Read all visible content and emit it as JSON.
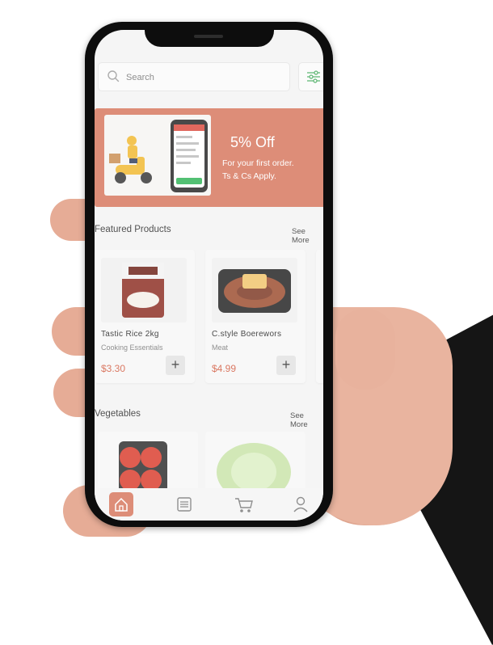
{
  "search": {
    "placeholder": "Search"
  },
  "banner": {
    "title": "5% Off",
    "subtitle_line1": "For your first order.",
    "subtitle_line2": "Ts & Cs Apply."
  },
  "featured": {
    "title": "Featured Products",
    "see_more": "See More",
    "products": [
      {
        "name": "Tastic  Rice 2kg",
        "category": "Cooking Essentials",
        "price": "$3.30"
      },
      {
        "name": "C.style Boerewors",
        "category": "Meat",
        "price": "$4.99"
      }
    ]
  },
  "vegetables": {
    "title": "Vegetables",
    "see_more": "See More"
  },
  "nav": {
    "items": [
      "home-icon",
      "orders-icon",
      "cart-icon",
      "profile-icon"
    ],
    "active": "home-icon"
  },
  "colors": {
    "accent": "#d6745b",
    "price": "#d25b40",
    "filter": "#3aa655"
  }
}
